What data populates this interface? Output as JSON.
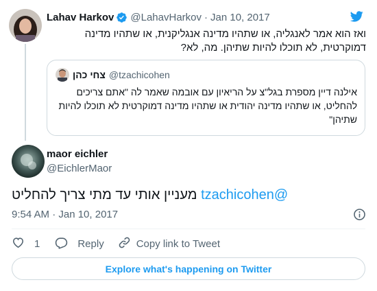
{
  "colors": {
    "accent": "#1d9bf0",
    "text": "#0f1419",
    "secondary": "#536471",
    "border": "#cfd9de"
  },
  "parent_tweet": {
    "name": "Lahav Harkov",
    "verified_icon": "verified-badge-icon",
    "handle": "@LahavHarkov",
    "separator": "·",
    "date": "Jan 10, 2017",
    "text": "ואז הוא אמר לאנגליה, או שתהיו מדינה אנגליקנית, או שתהיו מדינה דמוקרטית, לא תוכלו להיות שתיהן. מה, לא?",
    "quoted_tweet": {
      "name": "צחי כהן",
      "handle": "@tzachicohen",
      "text": "אילנה דיין מספרת בגל\"צ על הריאיון עם אובמה שאמר לה \"אתם צריכים להחליט, או שתהיו מדינה יהודית או שתהיו מדינה דמוקרטית לא תוכלו להיות שתיהן\""
    }
  },
  "main_tweet": {
    "name": "maor eichler",
    "handle": "@EichlerMaor",
    "mention": "@tzachicohen",
    "text": "מעניין אותי עד מתי צריך להחליט",
    "timestamp": "9:54 AM · Jan 10, 2017",
    "info_icon": "info-icon"
  },
  "actions": {
    "like_count": "1",
    "reply_label": "Reply",
    "copy_link_label": "Copy link to Tweet"
  },
  "explore_label": "Explore what's happening on Twitter",
  "brand_icon": "twitter-bird-icon"
}
